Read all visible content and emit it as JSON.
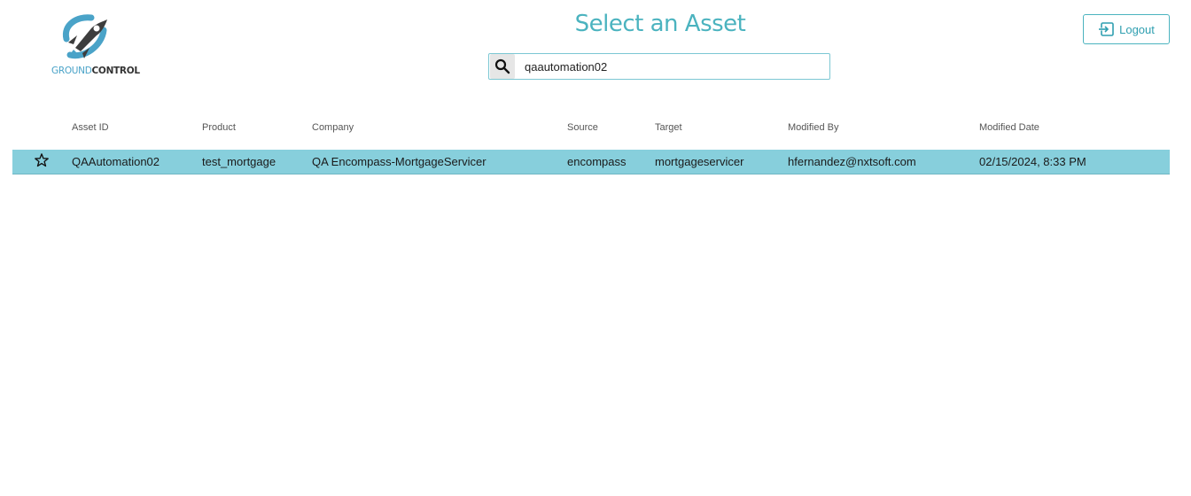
{
  "logo": {
    "ground": "GROUND",
    "control": "CONTROL",
    "icon": "rocket-icon"
  },
  "page_title": "Select an Asset",
  "search": {
    "icon": "search-icon",
    "value": "qaautomation02",
    "placeholder": ""
  },
  "logout": {
    "label": "Logout",
    "icon": "logout-icon"
  },
  "table": {
    "columns": [
      "Asset ID",
      "Product",
      "Company",
      "Source",
      "Target",
      "Modified By",
      "Modified Date"
    ],
    "rows": [
      {
        "favorite_icon": "star-outline-icon",
        "asset_id": "QAAutomation02",
        "product": "test_mortgage",
        "company": "QA Encompass-MortgageServicer",
        "source": "encompass",
        "target": "mortgageservicer",
        "modified_by": "hfernandez@nxtsoft.com",
        "modified_date": "02/15/2024, 8:33 PM"
      }
    ]
  },
  "colors": {
    "accent": "#4bb3bf",
    "selected_row": "#87cfdc",
    "logo_blue": "#4aa3c8"
  }
}
